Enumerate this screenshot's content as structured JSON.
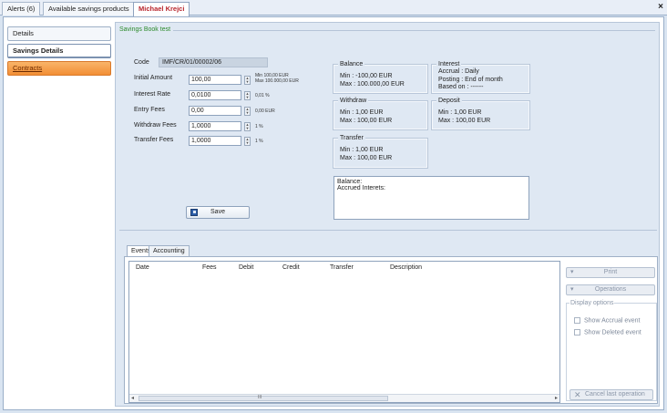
{
  "tabs": [
    {
      "label": "Alerts (6)"
    },
    {
      "label": "Available savings products"
    },
    {
      "label": "Michael Krejci"
    }
  ],
  "close_label": "×",
  "nav": {
    "details": "Details",
    "savings_details": "Savings Details",
    "contracts": "Contracts"
  },
  "group_title": "Savings Book test",
  "form": {
    "code_label": "Code",
    "code_value": "IMF/CR/01/00002/06",
    "initial_amount": {
      "label": "Initial Amount",
      "value": "100,00",
      "hint1": "Min 100,00 EUR",
      "hint2": "Max 100.000,00 EUR"
    },
    "interest_rate": {
      "label": "Interest Rate",
      "value": "0,0100",
      "hint": "0,01 %"
    },
    "entry_fees": {
      "label": "Entry Fees",
      "value": "0,00",
      "hint": "0,00 EUR"
    },
    "withdraw_fees": {
      "label": "Withdraw Fees",
      "value": "1,0000",
      "hint": "1 %"
    },
    "transfer_fees": {
      "label": "Transfer Fees",
      "value": "1,0000",
      "hint": "1 %"
    },
    "save_label": "Save"
  },
  "balance_box": {
    "title": "Balance",
    "min": "Min :  -100,00 EUR",
    "max": "Max :  100.000,00 EUR"
  },
  "interest_box": {
    "title": "Interest",
    "accrual": "Accrual :  Daily",
    "posting": "Posting :  End of month",
    "based_on": "Based on :  ------"
  },
  "withdraw_box": {
    "title": "Withdraw",
    "min": "Min :  1,00 EUR",
    "max": "Max :  100,00 EUR"
  },
  "deposit_box": {
    "title": "Deposit",
    "min": "Min :  1,00 EUR",
    "max": "Max :  100,00 EUR"
  },
  "transfer_box": {
    "title": "Transfer",
    "min": "Min :  1,00 EUR",
    "max": "Max :  100,00 EUR"
  },
  "balance_text": {
    "line1": "Balance:",
    "line2": "Accrued Interets:"
  },
  "events": {
    "tab_events": "Events",
    "tab_accounting": "Accounting",
    "columns": [
      "Date",
      "Fees",
      "Debit",
      "Credit",
      "Transfer",
      "Description"
    ],
    "scroll_marker": "III"
  },
  "right_panel": {
    "print": "Print",
    "operations": "Operations",
    "display_options": "Display options",
    "show_accrual": "Show Accrual event",
    "show_deleted": "Show Deleted event",
    "cancel_last": "Cancel last operation"
  }
}
